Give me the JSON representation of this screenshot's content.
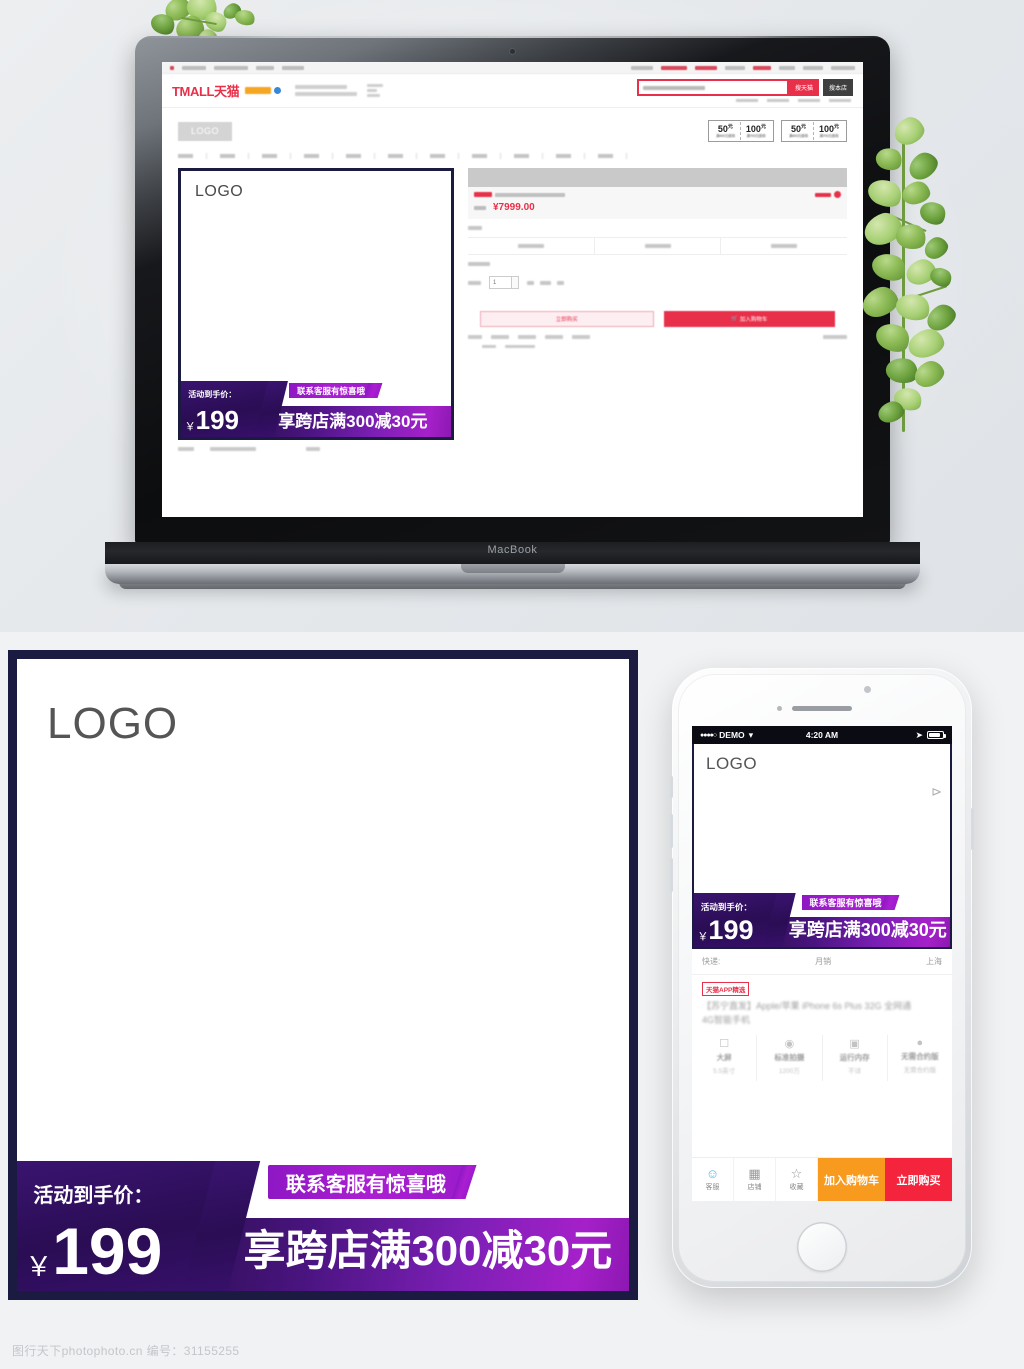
{
  "scene_top": {
    "device_label": "MacBook",
    "tmall": {
      "logo": "TMALL天猫",
      "search_tmall_button": "搜天猫",
      "search_shop_button": "搜本店",
      "shop_logo_placeholder": "LOGO",
      "coupons": [
        {
          "amount": "50",
          "unit": "元",
          "condition": "满400元使用"
        },
        {
          "amount": "100",
          "unit": "元",
          "condition": "满700元使用"
        },
        {
          "amount": "50",
          "unit": "元",
          "condition": "满400元使用"
        },
        {
          "amount": "100",
          "unit": "元",
          "condition": "满700元使用"
        }
      ],
      "product_price": "¥7999.00",
      "quantity_value": "1",
      "buy_now_button": "立即购买",
      "add_to_cart_button": "加入购物车"
    },
    "product_card": {
      "logo": "LOGO",
      "promo": {
        "price_label": "活动到手价：",
        "currency": "￥",
        "price": "199",
        "tag": "联系客服有惊喜哦",
        "main": "享跨店满300减30元"
      }
    }
  },
  "scene_bottom": {
    "big_card": {
      "logo": "LOGO",
      "promo": {
        "price_label": "活动到手价：",
        "currency": "￥",
        "price": "199",
        "tag": "联系客服有惊喜哦",
        "main": "享跨店满300减30元"
      }
    },
    "phone": {
      "status": {
        "carrier": "DEMO",
        "time": "4:20 AM",
        "signal_dots": "●●●●○"
      },
      "logo": "LOGO",
      "promo": {
        "price_label": "活动到手价：",
        "currency": "￥",
        "price": "199",
        "tag": "联系客服有惊喜哦",
        "main": "享跨店满300减30元"
      },
      "info_row": {
        "left": "快递:",
        "center": "月销",
        "right": "上海"
      },
      "app_tag": "天猫APP精选",
      "title": "【苏宁直发】Apple/苹果 iPhone 6s Plus 32G 全网通4G智能手机",
      "specs": [
        {
          "icon": "screen-icon",
          "name": "大屏",
          "value": "5.5英寸"
        },
        {
          "icon": "camera-icon",
          "name": "标准拍摄",
          "value": "1200万"
        },
        {
          "icon": "memory-icon",
          "name": "运行内存",
          "value": "不详"
        },
        {
          "icon": "contract-icon",
          "name": "无需合约版",
          "value": "无需合约版"
        }
      ],
      "bottom_bar": {
        "service": "客服",
        "shop": "店铺",
        "favorite": "收藏",
        "add_cart": "加入购物车",
        "buy_now": "立即购买"
      }
    }
  },
  "watermark": "图行天下photophoto.cn  编号：31155255",
  "colors": {
    "card_border": "#1b1b42",
    "promo_purple_dark": "#2a0d54",
    "promo_purple_bright": "#a520c9",
    "tmall_red": "#e8304a",
    "cart_orange": "#f79a1e",
    "buy_red": "#f5243d"
  }
}
